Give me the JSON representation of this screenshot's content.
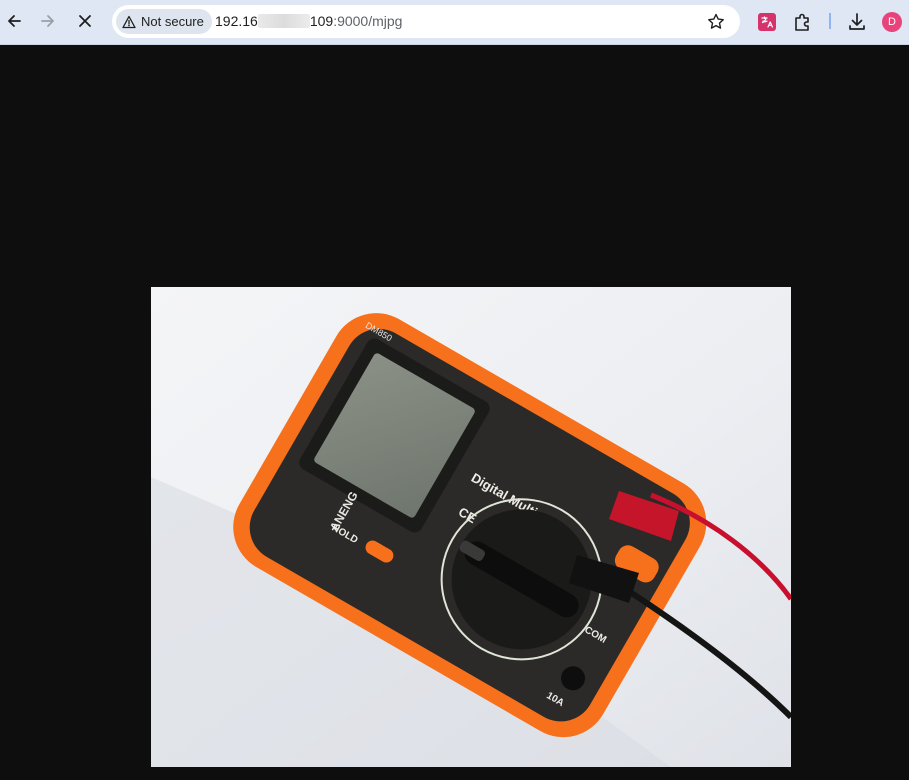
{
  "browser": {
    "security_label": "Not secure",
    "url_host_prefix": "192.16",
    "url_host_suffix": "109",
    "url_rest": ":9000/mjpg",
    "profile_initial": "D"
  },
  "icons": {
    "back": "arrow-left-icon",
    "forward": "arrow-right-icon",
    "stop": "close-icon",
    "security": "warning-triangle-icon",
    "bookmark": "star-icon",
    "translate": "translate-icon",
    "extensions": "puzzle-icon",
    "downloads": "download-icon"
  },
  "stream": {
    "meter_brand": "ANENG",
    "meter_model": "DM850",
    "meter_label": "Digital Multimeter",
    "hold_label": "HOLD",
    "ce_mark": "CE",
    "port_10a": "10A",
    "port_com": "COM"
  },
  "colors": {
    "toolbar_bg": "#dfe7f5",
    "page_bg": "#0e0e0e",
    "meter_orange": "#f7701c",
    "avatar": "#e8437a"
  }
}
